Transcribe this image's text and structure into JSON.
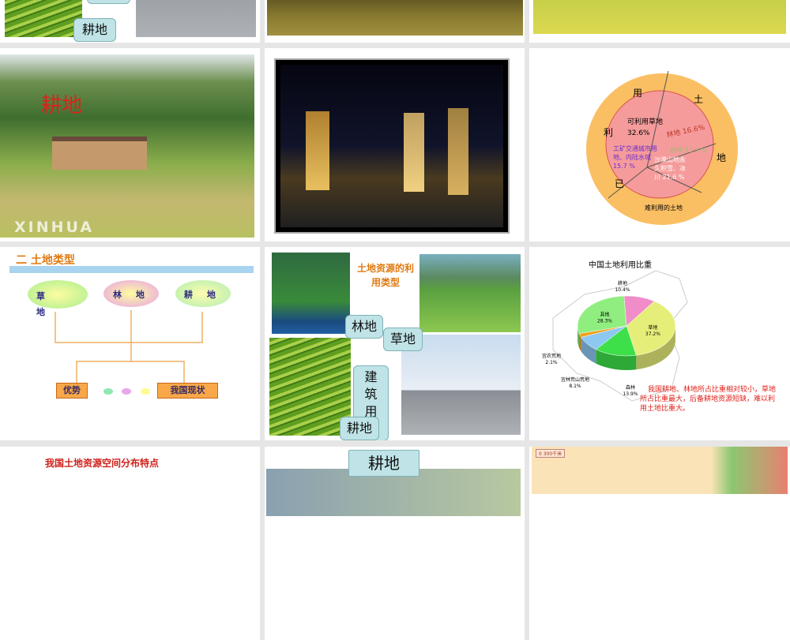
{
  "slides": [
    {
      "id": 1,
      "callouts": [
        "耕地"
      ]
    },
    {
      "id": 2
    },
    {
      "id": 3
    },
    {
      "id": 4,
      "overlay_text": "耕地",
      "watermark": "XINHUA"
    },
    {
      "id": 5
    },
    {
      "id": 6,
      "labels": {
        "outer_chars": [
          "用",
          "土",
          "地",
          "已",
          "利"
        ],
        "outer_bottom": "难利用的土地",
        "grass": "可利用草地",
        "grass_pct": "32.6%",
        "forest": "林地 16.6%",
        "industry": "工矿交通城市用地、内陆水域 15.7 %",
        "farmland": "耕地 13.5 %",
        "desert": "沙漠山地永久积雪、冰川 21.6 %"
      }
    },
    {
      "id": 7,
      "title": "二 土地类型",
      "nodes": [
        "草 地",
        "林 地",
        "耕 地"
      ],
      "boxes": [
        "优势",
        "我国现状"
      ]
    },
    {
      "id": 8,
      "title": "土地资源的利用类型",
      "callouts": [
        "林地",
        "草地",
        "建筑用地",
        "耕地"
      ]
    },
    {
      "id": 9,
      "note": "我国耕地、林地所占比重相对较小，草地所占比重最大，后备耕地资源短缺，难以利用土地比重大。"
    },
    {
      "id": 10,
      "title": "我国土地资源空间分布特点"
    },
    {
      "id": 11,
      "callout": "耕地"
    },
    {
      "id": 12,
      "scale": "0   300千米"
    }
  ],
  "chart_data": {
    "type": "pie",
    "title": "中国土地利用比重",
    "categories": [
      "耕地",
      "草地",
      "森林",
      "宜林荒山荒地",
      "宜农荒地",
      "其他"
    ],
    "values": [
      10.4,
      37.2,
      13.9,
      8.1,
      2.1,
      28.3
    ],
    "labels": [
      "10.4%",
      "37.2%",
      "13.9%",
      "8.1%",
      "2.1%",
      "28.3%"
    ],
    "colors": [
      "#f08cc8",
      "#e6ee7a",
      "#3ee04a",
      "#8cc8f0",
      "#f0a020",
      "#90ee80"
    ]
  }
}
